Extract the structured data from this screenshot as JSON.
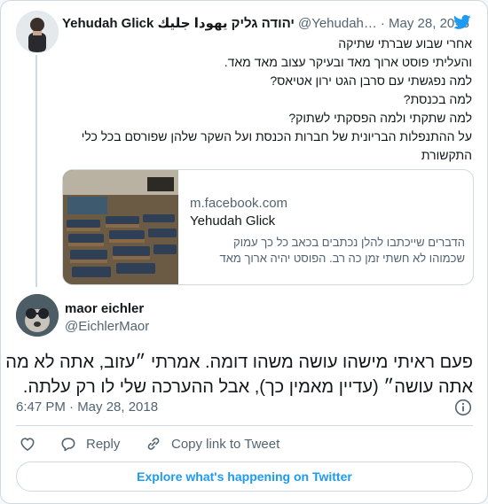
{
  "colors": {
    "accent": "#1d9bf0",
    "text": "#14171a",
    "muted": "#536471",
    "border": "#cfd9de"
  },
  "quoted_tweet": {
    "author_name": "Yehudah Glick יהודה גליק يهودا جليك",
    "handle": "@Yehudah…",
    "date": "· May 28, 2018",
    "icon": "twitter-bird-icon",
    "lines": [
      "אחרי שבוע שברתי שתיקה",
      "והעליתי פוסט ארוך מאד ובעיקר עצוב מאד מאד.",
      "למה נפגשתי עם סרבן הגט ירון אטיאס?",
      "למה בכנסת?",
      "למה שתקתי ולמה הפסקתי לשתוק?",
      "על ההתנפלות הבריונית של חברות הכנסת ועל השקר שלהן שפורסם בכל כלי",
      "התקשורת"
    ],
    "link_card": {
      "domain": "m.facebook.com",
      "title": "Yehudah Glick",
      "description_lines": [
        "הדברים שייכתבו להלן נכתבים בכאב כל כך עמוק",
        "שכמוהו לא חשתי זמן כה רב. הפוסט יהיה ארוך מאד"
      ]
    }
  },
  "main_tweet": {
    "author_name": "maor eichler",
    "handle": "@EichlerMaor",
    "lines": [
      "פעם ראיתי מישהו עושה משהו דומה. אמרתי ״עזוב, אתה לא מה",
      "אתה עושה״ (עדיין מאמין כך), אבל ההערכה שלי לו רק עלתה."
    ],
    "timestamp": "6:47 PM · May 28, 2018"
  },
  "actions": {
    "like_icon": "heart-icon",
    "reply_label": "Reply",
    "copy_link_label": "Copy link to Tweet"
  },
  "explore_label": "Explore what's happening on Twitter"
}
